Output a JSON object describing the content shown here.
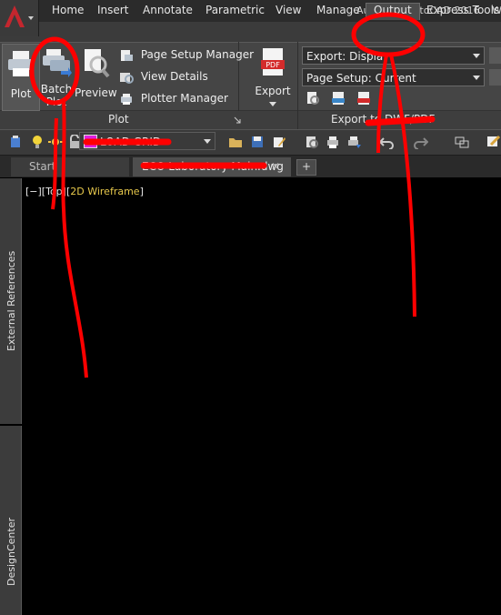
{
  "window": {
    "title": "Autodesk AutoCAD 2016",
    "title_suffix": "W"
  },
  "ribbon_tabs": [
    {
      "label": "Home"
    },
    {
      "label": "Insert"
    },
    {
      "label": "Annotate"
    },
    {
      "label": "Parametric"
    },
    {
      "label": "View"
    },
    {
      "label": "Manage"
    },
    {
      "label": "Output"
    },
    {
      "label": "Express Tools"
    }
  ],
  "active_tab": "Output",
  "plot_panel": {
    "title": "Plot",
    "plot_label": "Plot",
    "batch_plot_label_1": "Batch",
    "batch_plot_label_2": "Plot",
    "preview_label": "Preview",
    "page_setup_manager": "Page Setup Manager",
    "view_details": "View Details",
    "plotter_manager": "Plotter Manager"
  },
  "export_panel": {
    "title": "Export to DWF/PDF",
    "export_label": "Export",
    "export_dropdown": "Export: Display",
    "page_setup_dropdown": "Page Setup: Current"
  },
  "layer": {
    "name": "LOAD GRID"
  },
  "file_tabs": [
    {
      "label": "Start"
    },
    {
      "label": "ECO Laboratory Main.dwg"
    }
  ],
  "viewport": {
    "bracket_1": "[−][",
    "view": "Top",
    "bracket_2": "][",
    "mode": "2D Wireframe",
    "bracket_3": "]"
  },
  "palettes": {
    "external_references": "External References",
    "design_center": "DesignCenter"
  },
  "colors": {
    "accent_red": "#e21b1b",
    "autocad_red": "#c4262e",
    "annotation_red": "#ff0000",
    "wireframe_yellow": "#e8c94c"
  }
}
